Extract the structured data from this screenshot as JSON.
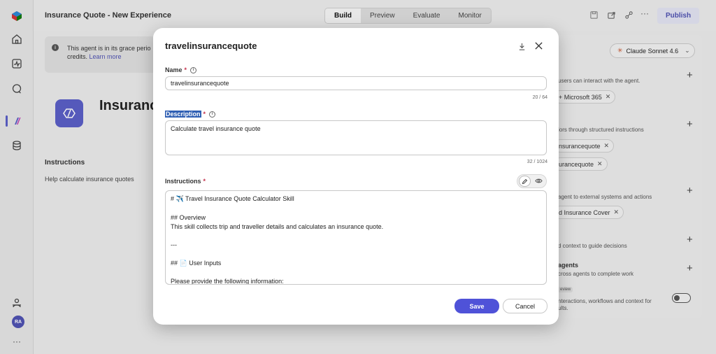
{
  "app": {
    "title": "Insurance Quote - New Experience",
    "tabs": [
      "Build",
      "Preview",
      "Evaluate",
      "Monitor"
    ],
    "active_tab": "Build",
    "publish_label": "Publish",
    "user_initials": "RA",
    "accent": "#4f52d8"
  },
  "background": {
    "banner_text": "This agent is in its grace perio",
    "banner_text2": "credits.",
    "banner_link": "Learn more",
    "agent_name": "Insuranc",
    "instructions_heading": "Instructions",
    "instructions_text": "Help calculate insurance quotes",
    "model_label": "Claude Sonnet 4.6",
    "right_panel": {
      "text1": "users can interact with the agent.",
      "chip1": "+ Microsoft 365",
      "text2": "iors through structured instructions",
      "chip2": "nsurancequote",
      "chip3": "urancequote",
      "text3": "agent to external systems and actions",
      "chip4": "d Insurance Cover",
      "text4": "d context to guide decisions",
      "agents_heading": "agents",
      "agents_text": "cross agents to complete work",
      "preview_tag": "eview",
      "workflows_text1": "nteractions, workflows and context for",
      "workflows_text2": "ults."
    }
  },
  "modal": {
    "title": "travelinsurancequote",
    "name_label": "Name",
    "name_value": "travelinsurancequote",
    "name_counter": "20 / 64",
    "description_label": "Description",
    "description_value": "Calculate travel insurance quote",
    "description_counter": "32 / 1024",
    "instructions_label": "Instructions",
    "instructions_lines": [
      "# ✈️ Travel Insurance Quote Calculator Skill",
      "## Overview",
      "This skill collects trip and traveller details and calculates an insurance quote.",
      "---",
      "## 📄 User Inputs",
      "Please provide the following information:"
    ],
    "save_label": "Save",
    "cancel_label": "Cancel"
  }
}
